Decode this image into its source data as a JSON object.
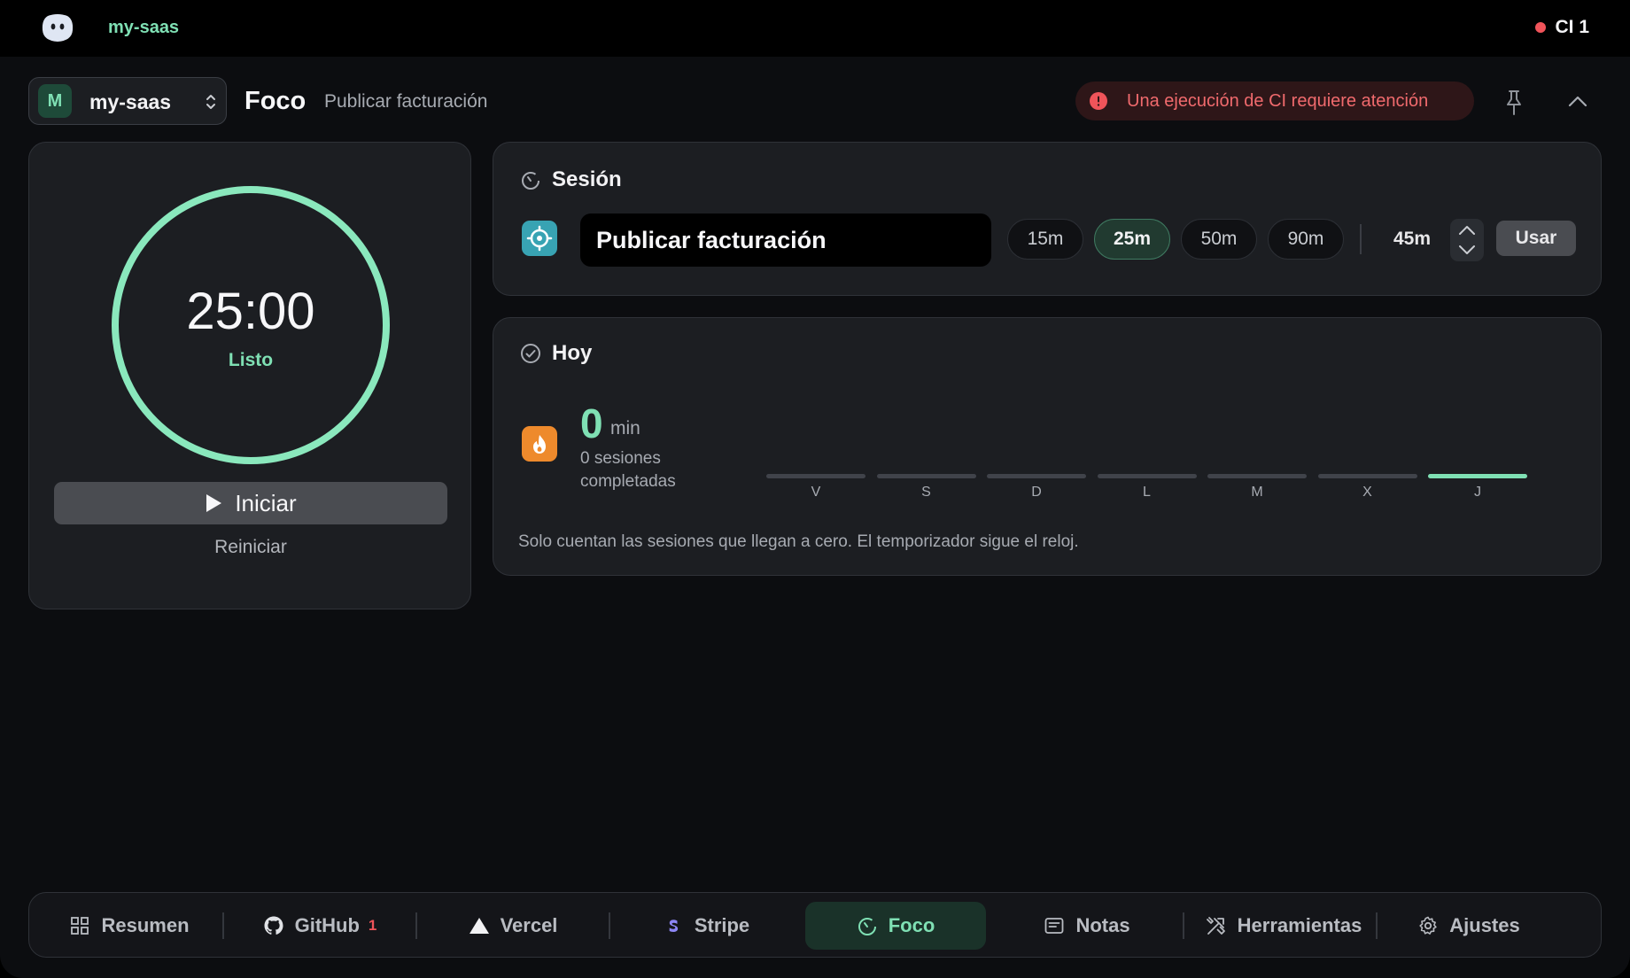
{
  "topbar": {
    "app_name": "my-saas",
    "ci_label": "CI 1",
    "ci_dot_color": "#f0545a"
  },
  "header": {
    "project_avatar": "M",
    "project_name": "my-saas",
    "page_title": "Foco",
    "page_subtitle": "Publicar facturación",
    "alert_text": "Una ejecución de CI requiere atención"
  },
  "timer": {
    "value": "25:00",
    "status": "Listo",
    "progress": 1.0,
    "start_label": "Iniciar",
    "reset_label": "Reiniciar"
  },
  "session": {
    "title": "Sesión",
    "task_value": "Publicar facturación",
    "presets": [
      "15m",
      "25m",
      "50m",
      "90m"
    ],
    "active_preset": "25m",
    "custom_value": "45m",
    "use_label": "Usar"
  },
  "today": {
    "title": "Hoy",
    "minutes": "0",
    "minutes_unit": "min",
    "sessions_text": "0 sesiones completadas",
    "days": [
      "V",
      "S",
      "D",
      "L",
      "M",
      "X",
      "J"
    ],
    "current_day": "J",
    "note": "Solo cuentan las sesiones que llegan a cero. El temporizador sigue el reloj."
  },
  "nav": {
    "items": [
      {
        "label": "Resumen",
        "icon": "grid-icon"
      },
      {
        "label": "GitHub",
        "icon": "github-icon",
        "badge": "1"
      },
      {
        "label": "Vercel",
        "icon": "triangle-icon"
      },
      {
        "label": "Stripe",
        "icon": "stripe-icon"
      },
      {
        "label": "Foco",
        "icon": "timer-icon",
        "active": true
      },
      {
        "label": "Notas",
        "icon": "notes-icon"
      },
      {
        "label": "Herramientas",
        "icon": "tools-icon"
      },
      {
        "label": "Ajustes",
        "icon": "gear-icon"
      }
    ]
  },
  "colors": {
    "accent": "#7fe0b4",
    "alert": "#f06a6d",
    "warning": "#ee8a2c",
    "teal": "#38a3b3"
  }
}
